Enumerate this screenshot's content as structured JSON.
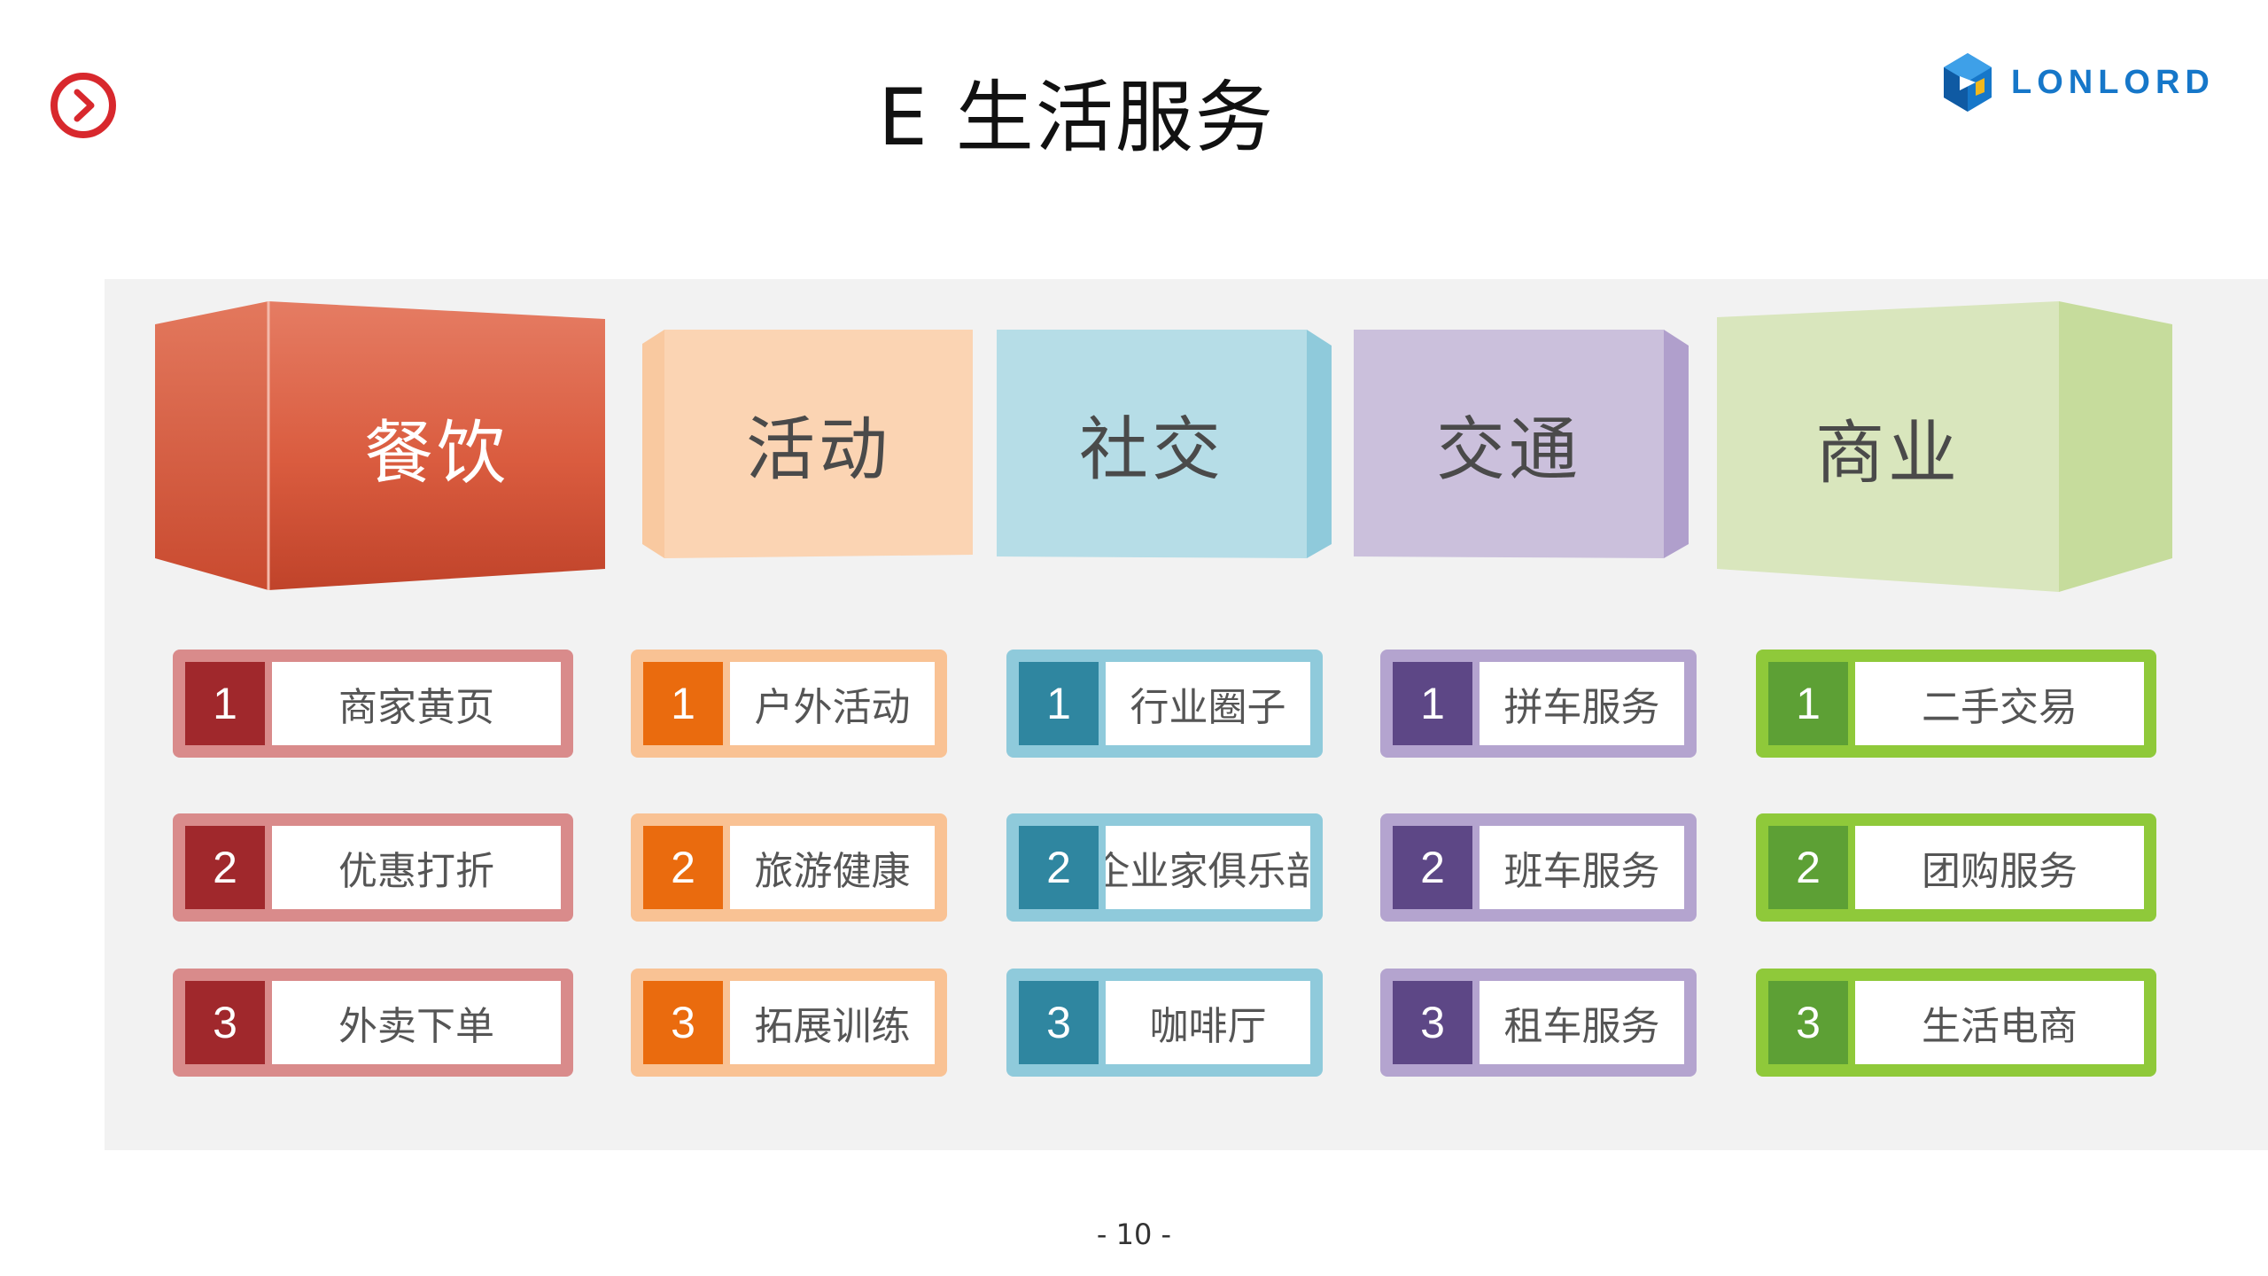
{
  "header": {
    "title": "E 生活服务",
    "logo_text": "LONLORD"
  },
  "colors": {
    "nav_red": "#d8282d",
    "logo_blue": "#1677c9",
    "band_bg": "#f2f2f2"
  },
  "categories": [
    {
      "label": "餐饮",
      "face_color": "#d5553b",
      "text_color": "#ffffff",
      "item_border": "#d98b8b",
      "num_bg": "#a0282c",
      "items": [
        {
          "num": "1",
          "label": "商家黄页"
        },
        {
          "num": "2",
          "label": "优惠打折"
        },
        {
          "num": "3",
          "label": "外卖下单"
        }
      ]
    },
    {
      "label": "活动",
      "face_color": "#fbd4b3",
      "text_color": "#4a4a4a",
      "item_border": "#f9c294",
      "num_bg": "#ea6b0e",
      "items": [
        {
          "num": "1",
          "label": "户外活动"
        },
        {
          "num": "2",
          "label": "旅游健康"
        },
        {
          "num": "3",
          "label": "拓展训练"
        }
      ]
    },
    {
      "label": "社交",
      "face_color": "#b6dde7",
      "text_color": "#4a4a4a",
      "item_border": "#8fcadb",
      "num_bg": "#2f86a0",
      "items": [
        {
          "num": "1",
          "label": "行业圈子"
        },
        {
          "num": "2",
          "label": "企业家俱乐部"
        },
        {
          "num": "3",
          "label": "咖啡厅"
        }
      ]
    },
    {
      "label": "交通",
      "face_color": "#cbc0dc",
      "text_color": "#4a4a4a",
      "item_border": "#b4a4cf",
      "num_bg": "#5d4786",
      "items": [
        {
          "num": "1",
          "label": "拼车服务"
        },
        {
          "num": "2",
          "label": "班车服务"
        },
        {
          "num": "3",
          "label": "租车服务"
        }
      ]
    },
    {
      "label": "商业",
      "face_color": "#d9e6bd",
      "text_color": "#4a4a4a",
      "item_border": "#8fc93a",
      "num_bg": "#5da035",
      "items": [
        {
          "num": "1",
          "label": "二手交易"
        },
        {
          "num": "2",
          "label": "团购服务"
        },
        {
          "num": "3",
          "label": "生活电商"
        }
      ]
    }
  ],
  "footer": {
    "page_number": "- 10 -"
  }
}
